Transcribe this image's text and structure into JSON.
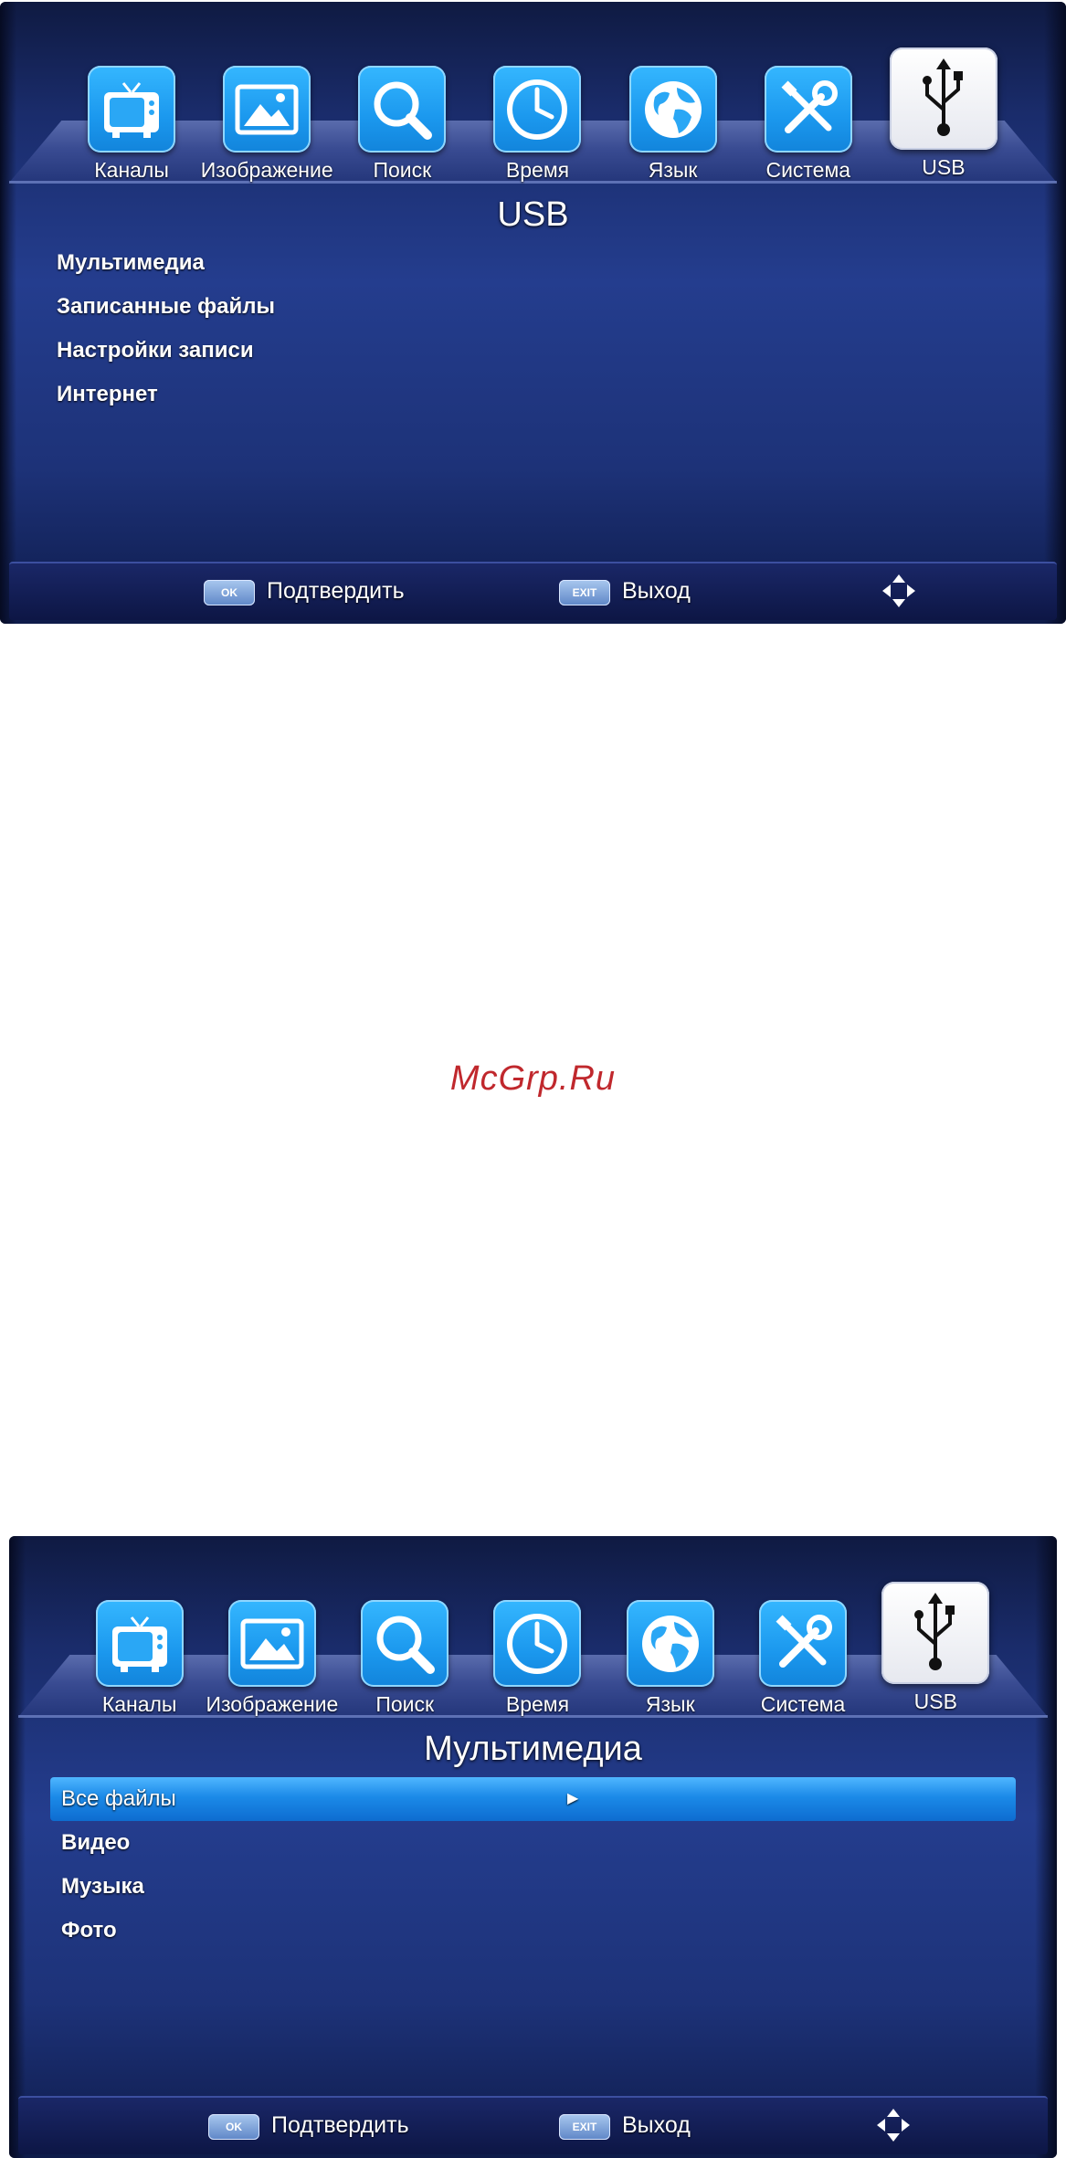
{
  "screen1": {
    "tabs": [
      {
        "label": "Каналы",
        "icon": "tv-icon"
      },
      {
        "label": "Изображение",
        "icon": "picture-icon"
      },
      {
        "label": "Поиск",
        "icon": "search-icon"
      },
      {
        "label": "Время",
        "icon": "clock-icon"
      },
      {
        "label": "Язык",
        "icon": "globe-icon"
      },
      {
        "label": "Система",
        "icon": "tools-icon"
      },
      {
        "label": "USB",
        "icon": "usb-icon",
        "active": true
      }
    ],
    "title": "USB",
    "menu": [
      "Мультимедиа",
      "Записанные файлы",
      "Настройки записи",
      "Интернет"
    ],
    "footer": {
      "ok_key": "OK",
      "ok_label": "Подтвердить",
      "exit_key": "EXIT",
      "exit_label": "Выход"
    }
  },
  "watermark": "McGrp.Ru",
  "screen2": {
    "tabs": [
      {
        "label": "Каналы",
        "icon": "tv-icon"
      },
      {
        "label": "Изображение",
        "icon": "picture-icon"
      },
      {
        "label": "Поиск",
        "icon": "search-icon"
      },
      {
        "label": "Время",
        "icon": "clock-icon"
      },
      {
        "label": "Язык",
        "icon": "globe-icon"
      },
      {
        "label": "Система",
        "icon": "tools-icon"
      },
      {
        "label": "USB",
        "icon": "usb-icon",
        "active": true
      }
    ],
    "title": "Мультимедиа",
    "menu": [
      "Все файлы",
      "Видео",
      "Музыка",
      "Фото"
    ],
    "selected_index": 0,
    "footer": {
      "ok_key": "OK",
      "ok_label": "Подтвердить",
      "exit_key": "EXIT",
      "exit_label": "Выход"
    }
  },
  "colors": {
    "accent": "#1b98ee",
    "selected": "#1b8ae8",
    "watermark": "#c0282d"
  }
}
